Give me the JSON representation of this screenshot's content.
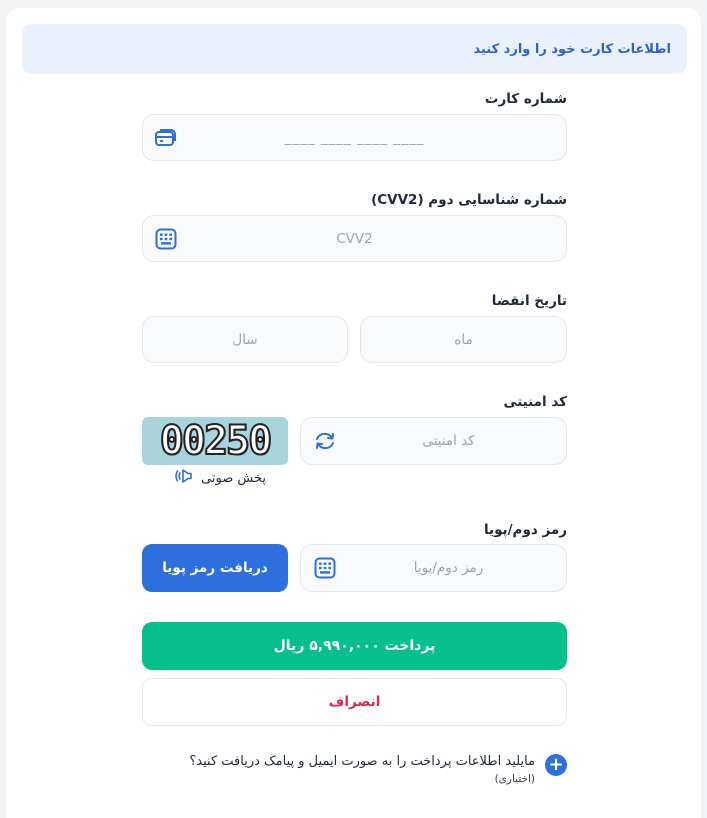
{
  "header": {
    "title": "اطلاعات کارت خود را وارد کنید"
  },
  "card_number": {
    "label": "شماره کارت",
    "placeholder": "____ ____ ____ ____",
    "icon": "card-icon"
  },
  "cvv2": {
    "label": "شماره شناسایی دوم (CVV2)",
    "placeholder": "CVV2",
    "icon": "keypad-icon"
  },
  "expiry": {
    "label": "تاریخ انقضا",
    "month_placeholder": "ماه",
    "year_placeholder": "سال"
  },
  "captcha": {
    "label": "کد امنیتی",
    "placeholder": "کد امنیتی",
    "image_text": "00250",
    "audio_label": "پخش صوتی",
    "refresh_icon": "refresh-icon",
    "audio_icon": "speaker-icon"
  },
  "dynamic_pin": {
    "label": "رمز دوم/پویا",
    "placeholder": "رمز دوم/پویا",
    "request_button": "دریافت رمز پویا",
    "icon": "keypad-icon"
  },
  "pay_button": "پرداخت ۵,۹۹۰,۰۰۰ ریال",
  "cancel_button": "انصراف",
  "optin": {
    "question": "مایلید اطلاعات پرداخت را به صورت ایمیل و پیامک دریافت کنید؟",
    "note": "(اختیاری)"
  },
  "colors": {
    "accent": "#2d6fdc",
    "pay": "#05c08c",
    "cancel": "#e0264b",
    "header_bg": "#eaf1fc"
  }
}
